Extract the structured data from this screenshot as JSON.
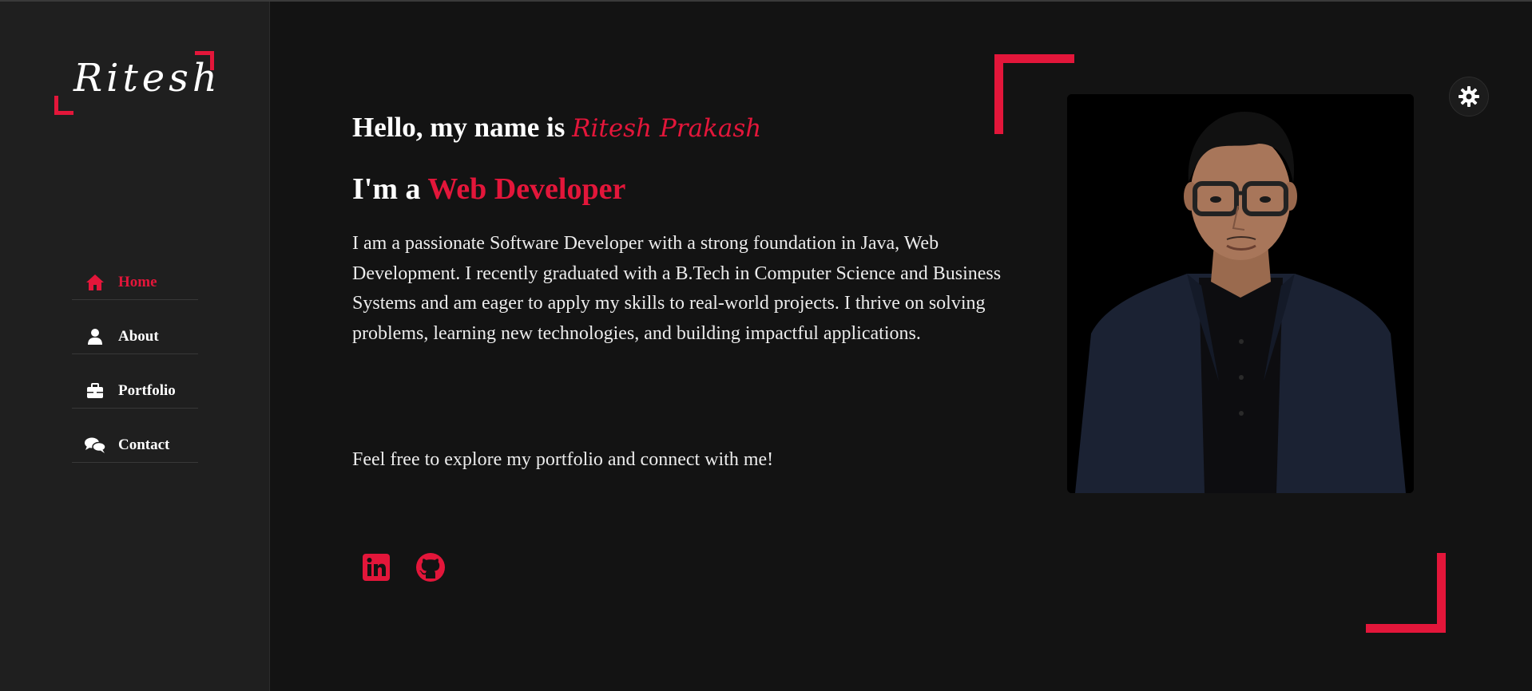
{
  "logo": {
    "text": "Ritesh"
  },
  "nav": {
    "items": [
      {
        "label": "Home",
        "icon": "home-icon",
        "active": true
      },
      {
        "label": "About",
        "icon": "user-icon",
        "active": false
      },
      {
        "label": "Portfolio",
        "icon": "briefcase-icon",
        "active": false
      },
      {
        "label": "Contact",
        "icon": "chat-icon",
        "active": false
      }
    ]
  },
  "hero": {
    "greeting_prefix": "Hello, my name is ",
    "name": "Ritesh Prakash",
    "role_prefix": "I'm a ",
    "role": "Web Developer",
    "bio": "I am a passionate Software Developer with a strong foundation in Java, Web Development. I recently graduated with a B.Tech in Computer Science and Business Systems and am eager to apply my skills to real-world projects. I thrive on solving problems, learning new technologies, and building impactful applications.",
    "cta": "Feel free to explore my portfolio and connect with me!"
  },
  "socials": [
    {
      "icon": "linkedin-icon"
    },
    {
      "icon": "github-icon"
    }
  ],
  "theme_toggle": {
    "icon": "gear-icon"
  },
  "colors": {
    "accent": "#e3163a",
    "background": "#131313",
    "sidebar": "#1f1f1f"
  }
}
